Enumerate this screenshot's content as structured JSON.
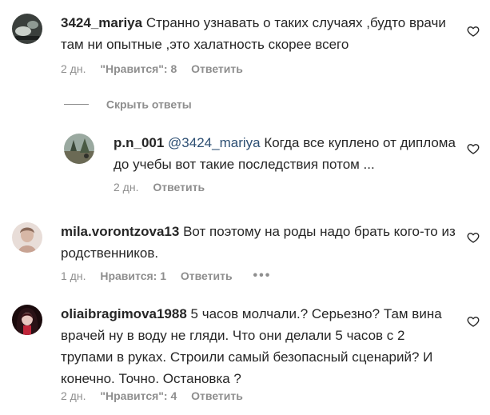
{
  "comments": [
    {
      "username": "3424_mariya",
      "text": "Странно узнавать о таких случаях ,будто врачи там ни опытные ,это халатность скорее всего",
      "time": "2 дн.",
      "likes": "\"Нравится\": 8",
      "reply": "Ответить"
    },
    {
      "username": "p.n_001",
      "mention": "@3424_mariya",
      "text": "Когда все куплено от диплома до учебы вот такие последствия потом ...",
      "time": "2 дн.",
      "reply": "Ответить"
    },
    {
      "username": "mila.vorontzova13",
      "text": "Вот поэтому на роды надо брать кого-то из родственников.",
      "time": "1 дн.",
      "likes": "Нравится: 1",
      "reply": "Ответить",
      "more": "•••"
    },
    {
      "username": "oliaibragimova1988",
      "text": "5 часов молчали.? Серьезно? Там вина врачей ну в воду не гляди. Что они делали 5 часов с 2 трупами в руках. Строили самый безопасный сценарий? И конечно. Точно. Остановка ?",
      "time": "2 дн.",
      "likes": "\"Нравится\": 4",
      "reply": "Ответить"
    }
  ],
  "hide_replies": "Скрыть ответы",
  "icons": {
    "heart": "heart-outline-icon",
    "more": "more-options-icon"
  }
}
